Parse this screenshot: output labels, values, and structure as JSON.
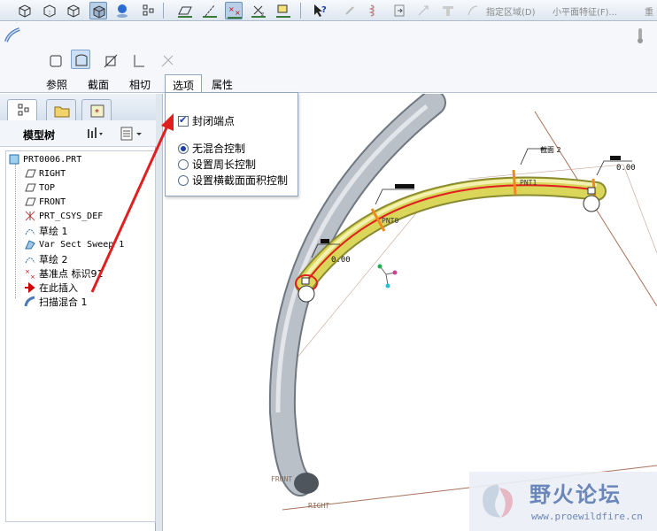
{
  "toolbar": {
    "items": [
      {
        "name": "view-isometric-icon"
      },
      {
        "name": "view-hidden-icon"
      },
      {
        "name": "view-nohidden-icon"
      },
      {
        "name": "view-shaded-icon"
      },
      {
        "name": "render-icon"
      },
      {
        "name": "layer-icon"
      },
      {
        "name": "datum-plane-display-icon"
      },
      {
        "name": "datum-axis-display-icon"
      },
      {
        "name": "datum-point-display-icon"
      },
      {
        "name": "csys-display-icon"
      },
      {
        "name": "annotation-display-icon"
      },
      {
        "name": "whats-this-help-icon"
      }
    ],
    "filter_area_label": "指定区域(D)",
    "small_plane_label": "小平面特征(F)...",
    "tail_label": "重"
  },
  "dashboard": {
    "tabs": [
      {
        "id": "references",
        "label": "参照"
      },
      {
        "id": "sections",
        "label": "截面"
      },
      {
        "id": "tangency",
        "label": "相切"
      },
      {
        "id": "options",
        "label": "选项"
      },
      {
        "id": "properties",
        "label": "属性"
      }
    ],
    "active_tab": "options"
  },
  "options_panel": {
    "cap_ends_label": "封闭端点",
    "cap_ends_checked": true,
    "blend_options": [
      {
        "label": "无混合控制",
        "checked": true
      },
      {
        "label": "设置周长控制",
        "checked": false
      },
      {
        "label": "设置横截面面积控制",
        "checked": false
      }
    ]
  },
  "navigator": {
    "tree_title": "模型树",
    "items": [
      {
        "label": "PRT0006.PRT",
        "icon": "part-icon",
        "indent": 0
      },
      {
        "label": "RIGHT",
        "icon": "datum-plane-icon",
        "indent": 1
      },
      {
        "label": "TOP",
        "icon": "datum-plane-icon",
        "indent": 1
      },
      {
        "label": "FRONT",
        "icon": "datum-plane-icon",
        "indent": 1
      },
      {
        "label": "PRT_CSYS_DEF",
        "icon": "csys-icon",
        "indent": 1
      },
      {
        "label": "草绘 1",
        "icon": "sketch-icon",
        "indent": 1
      },
      {
        "label": "Var Sect Sweep 1",
        "icon": "var-sect-sweep-icon",
        "indent": 1
      },
      {
        "label": "草绘 2",
        "icon": "sketch-icon",
        "indent": 1
      },
      {
        "label": "基准点 标识91",
        "icon": "datum-point-icon",
        "indent": 1
      },
      {
        "label": "在此插入",
        "icon": "insert-here-arrow-icon",
        "indent": 1
      },
      {
        "label": "扫描混合 1",
        "icon": "swept-blend-icon",
        "indent": 1
      }
    ]
  },
  "viewport": {
    "labels": {
      "pnt0": "PNT0",
      "pnt1": "PNT1",
      "zero1": "0.00",
      "zero2": "0.00",
      "section2": "截面 2",
      "front": "FRONT",
      "right": "RIGHT"
    }
  },
  "watermark": {
    "title": "野火论坛",
    "url": "www.proewildfire.cn"
  },
  "colors": {
    "accent": "#1a3fae",
    "annotation_arrow": "#e02020",
    "tube": "#9aa3ad",
    "preview_yellow": "#d8d44a"
  }
}
